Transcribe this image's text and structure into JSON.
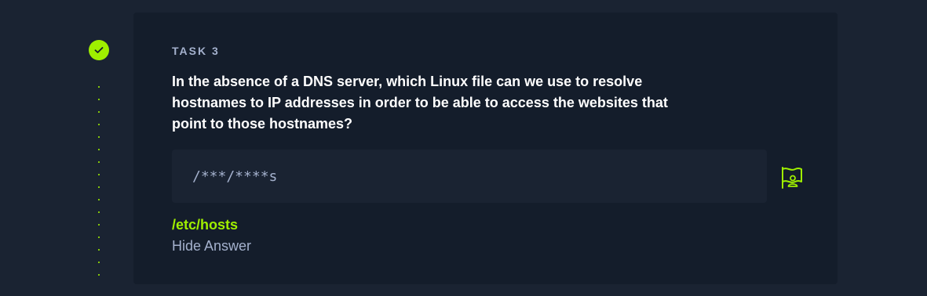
{
  "task": {
    "label": "TASK 3",
    "status": "completed",
    "question": "In the absence of a DNS server, which Linux file can we use to resolve hostnames to IP addresses in order to be able to access the websites that point to those hostnames?",
    "answer_placeholder": "/***/****s",
    "answer": "/etc/hosts",
    "hide_answer_label": "Hide Answer"
  },
  "icons": {
    "status": "check-icon",
    "submit": "flag-icon"
  },
  "colors": {
    "accent": "#9fef00",
    "page_bg": "#1a2332",
    "card_bg": "#141d2b",
    "muted_text": "#a4b1cd"
  }
}
